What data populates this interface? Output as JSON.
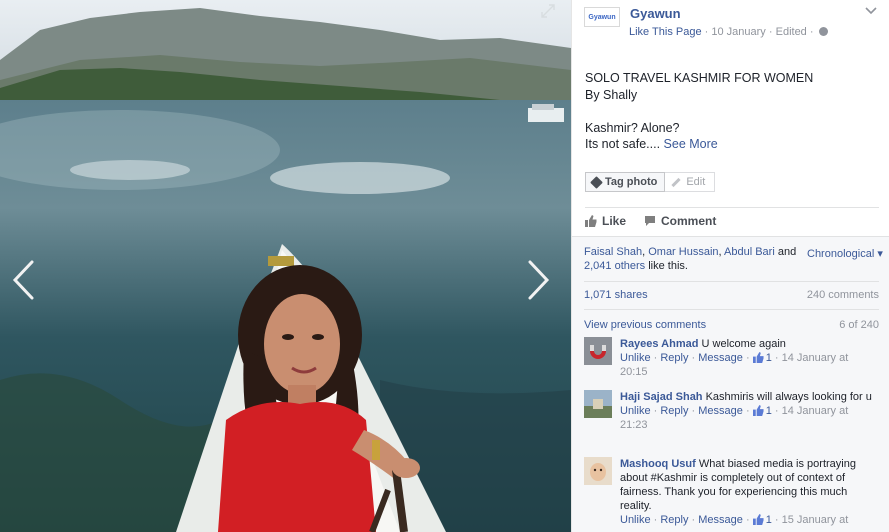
{
  "post": {
    "page_name": "Gyawun",
    "logo_text": "Gyawun",
    "like_page": "Like This Page",
    "date": "10 January",
    "edited": "Edited",
    "separator": "·",
    "text_line1": "SOLO TRAVEL KASHMIR FOR WOMEN",
    "text_line2": "By Shally",
    "text_line3": "Kashmir? Alone?",
    "text_line4": "Its not safe....",
    "see_more": "See More",
    "tag_photo": "Tag photo",
    "edit": "Edit",
    "like": "Like",
    "comment": "Comment"
  },
  "ufi": {
    "liker1": "Faisal Shah",
    "liker_sep": ",",
    "liker2": "Omar Hussain",
    "liker3": "Abdul Bari",
    "and": "and",
    "others": "2,041 others",
    "like_this": "like this.",
    "order": "Chronological",
    "shares": "1,071 shares",
    "comments_count": "240 comments",
    "view_previous": "View previous comments",
    "page_count": "6 of 240"
  },
  "comments": [
    {
      "author": "Rayees Ahmad",
      "text": "U welcome again",
      "unlike": "Unlike",
      "reply": "Reply",
      "message": "Message",
      "likes": "1",
      "time": "14 January at 20:15"
    },
    {
      "author": "Haji Sajad Shah",
      "text": "Kashmiris will always looking for u",
      "unlike": "Unlike",
      "reply": "Reply",
      "message": "Message",
      "likes": "1",
      "time": "14 January at 21:23"
    },
    {
      "author": "Mashooq Usuf",
      "text": "What biased media is portraying about #Kashmir is completely out of context of fairness. Thank you for experiencing this much reality.",
      "unlike": "Unlike",
      "reply": "Reply",
      "message": "Message",
      "likes": "1",
      "time": "15 January at"
    }
  ],
  "icons": {
    "prev": "chevron-left-icon",
    "next": "chevron-right-icon",
    "expand": "expand-icon",
    "globe": "globe-icon",
    "like": "thumbs-up-icon",
    "comment": "speech-bubble-icon",
    "tag": "tag-icon",
    "edit": "pencil-icon"
  },
  "colors": {
    "link": "#3b5998",
    "muted": "#90949c",
    "ufi_bg": "#f6f7f9",
    "shirt": "#d21f24"
  }
}
